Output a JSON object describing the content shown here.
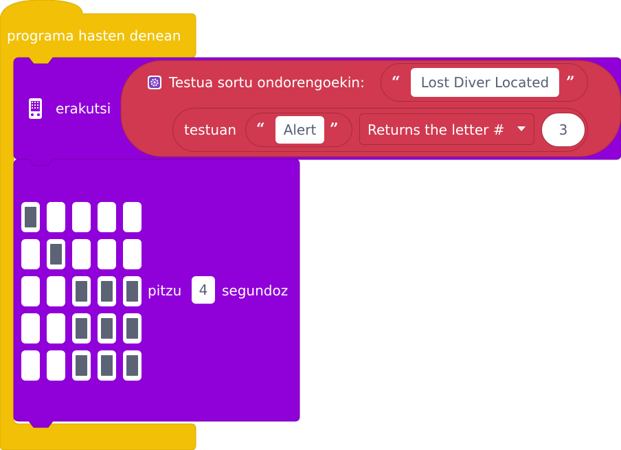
{
  "event_block": {
    "label": "programa hasten denean",
    "color": "#f1c007"
  },
  "show_block": {
    "label": "erakutsi",
    "color": "#9000d8",
    "join_block": {
      "label": "Testua sortu ondorengoekin:",
      "color": "#d0394f",
      "text_value": "Lost Diver Located",
      "char_at_block": {
        "label": "testuan",
        "text_value": "Alert",
        "dropdown_label": "Returns the letter #",
        "number_value": "3"
      }
    }
  },
  "show_leds_block": {
    "color": "#9000d8",
    "label_before": "pitzu",
    "duration_value": "4",
    "label_after": "segundoz",
    "leds": [
      [
        1,
        0,
        0,
        0,
        0
      ],
      [
        0,
        1,
        0,
        0,
        0
      ],
      [
        0,
        0,
        1,
        1,
        1
      ],
      [
        0,
        0,
        1,
        1,
        1
      ],
      [
        0,
        0,
        1,
        1,
        1
      ]
    ]
  },
  "icons": {
    "screen": "microbit-screen-icon",
    "gear": "gear-icon",
    "dropdown": "dropdown-caret-icon",
    "quote_open": "quote-open-icon",
    "quote_close": "quote-close-icon"
  }
}
